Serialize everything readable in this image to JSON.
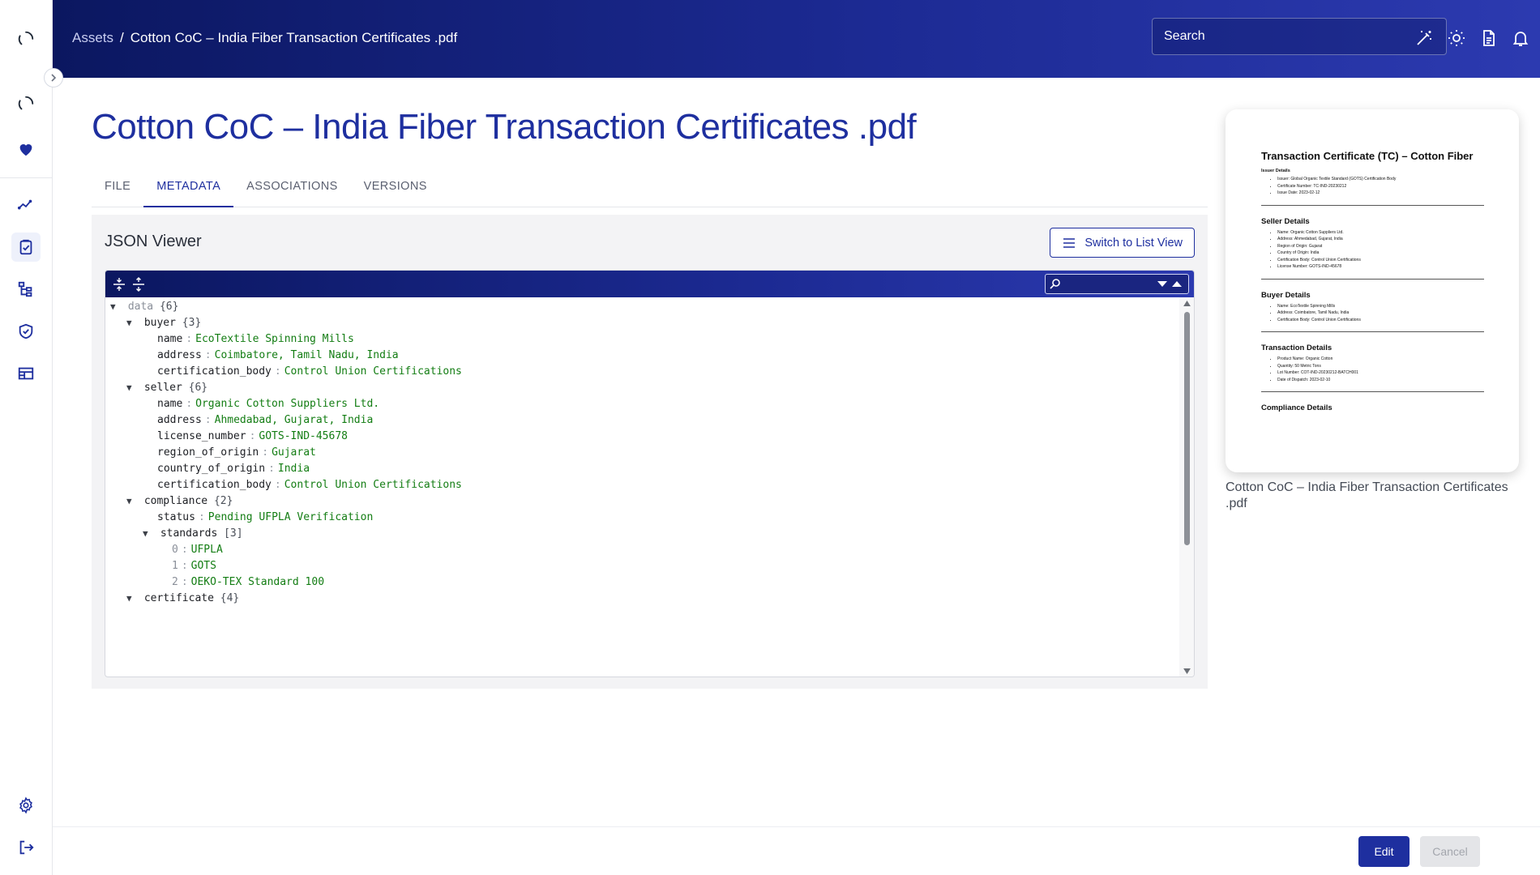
{
  "header": {
    "breadcrumb": {
      "root": "Assets",
      "separator": "/",
      "current": "Cotton CoC – India Fiber Transaction Certificates .pdf"
    },
    "search_placeholder": "Search",
    "icons": [
      "magic-wand-icon",
      "sun-icon",
      "document-icon",
      "bell-icon"
    ]
  },
  "sidebar": {
    "items": [
      "loading-spinner-icon",
      "loading-spinner-icon",
      "heart-icon",
      "analytics-icon",
      "clipboard-check-icon",
      "hierarchy-icon",
      "shield-check-icon",
      "table-icon",
      "gear-icon",
      "logout-icon"
    ],
    "active": "clipboard-check-icon"
  },
  "page": {
    "title": "Cotton CoC – India Fiber Transaction Certificates .pdf",
    "tabs": [
      "FILE",
      "METADATA",
      "ASSOCIATIONS",
      "VERSIONS"
    ],
    "active_tab": "METADATA"
  },
  "json_viewer": {
    "title": "JSON Viewer",
    "switch_label": "Switch to List View",
    "tree": {
      "root": {
        "key": "data",
        "count": "{6}"
      },
      "buyer": {
        "key": "buyer",
        "count": "{3}",
        "fields": [
          {
            "k": "name",
            "v": "EcoTextile Spinning Mills"
          },
          {
            "k": "address",
            "v": "Coimbatore, Tamil Nadu, India"
          },
          {
            "k": "certification_body",
            "v": "Control Union Certifications"
          }
        ]
      },
      "seller": {
        "key": "seller",
        "count": "{6}",
        "fields": [
          {
            "k": "name",
            "v": "Organic Cotton Suppliers Ltd."
          },
          {
            "k": "address",
            "v": "Ahmedabad, Gujarat, India"
          },
          {
            "k": "license_number",
            "v": "GOTS-IND-45678"
          },
          {
            "k": "region_of_origin",
            "v": "Gujarat"
          },
          {
            "k": "country_of_origin",
            "v": "India"
          },
          {
            "k": "certification_body",
            "v": "Control Union Certifications"
          }
        ]
      },
      "compliance": {
        "key": "compliance",
        "count": "{2}",
        "status": {
          "k": "status",
          "v": "Pending UFPLA Verification"
        },
        "standards": {
          "key": "standards",
          "count": "[3]",
          "items": [
            {
              "i": "0",
              "v": "UFPLA"
            },
            {
              "i": "1",
              "v": "GOTS"
            },
            {
              "i": "2",
              "v": "OEKO-TEX Standard 100"
            }
          ]
        }
      },
      "certificate": {
        "key": "certificate",
        "count": "{4}"
      }
    }
  },
  "preview": {
    "caption": "Cotton CoC – India Fiber Transaction Certificates .pdf",
    "doc": {
      "title": "Transaction Certificate (TC) – Cotton Fiber",
      "issuer_heading": "Issuer Details",
      "issuer_items": [
        "Issuer: Global Organic Textile Standard (GOTS) Certification Body",
        "Certificate Number: TC-IND-20230212",
        "Issue Date: 2023-02-12"
      ],
      "seller_heading": "Seller Details",
      "seller_items": [
        "Name: Organic Cotton Suppliers Ltd.",
        "Address: Ahmedabad, Gujarat, India",
        "Region of Origin: Gujarat",
        "Country of Origin: India",
        "Certification Body: Control Union Certifications",
        "License Number: GOTS-IND-45678"
      ],
      "buyer_heading": "Buyer Details",
      "buyer_items": [
        "Name: EcoTextile Spinning Mills",
        "Address: Coimbatore, Tamil Nadu, India",
        "Certification Body: Control Union Certifications"
      ],
      "transaction_heading": "Transaction Details",
      "transaction_items": [
        "Product Name: Organic Cotton",
        "Quantity: 50 Metric Tons",
        "Lot Number: COT-IND-20230212-BATCH001",
        "Date of Dispatch: 2023-02-10"
      ],
      "compliance_heading": "Compliance Details"
    }
  },
  "footer": {
    "edit_label": "Edit",
    "cancel_label": "Cancel"
  },
  "colors": {
    "primary": "#1e2f9f",
    "header_dark": "#0b1760",
    "value_green": "#137d13"
  }
}
